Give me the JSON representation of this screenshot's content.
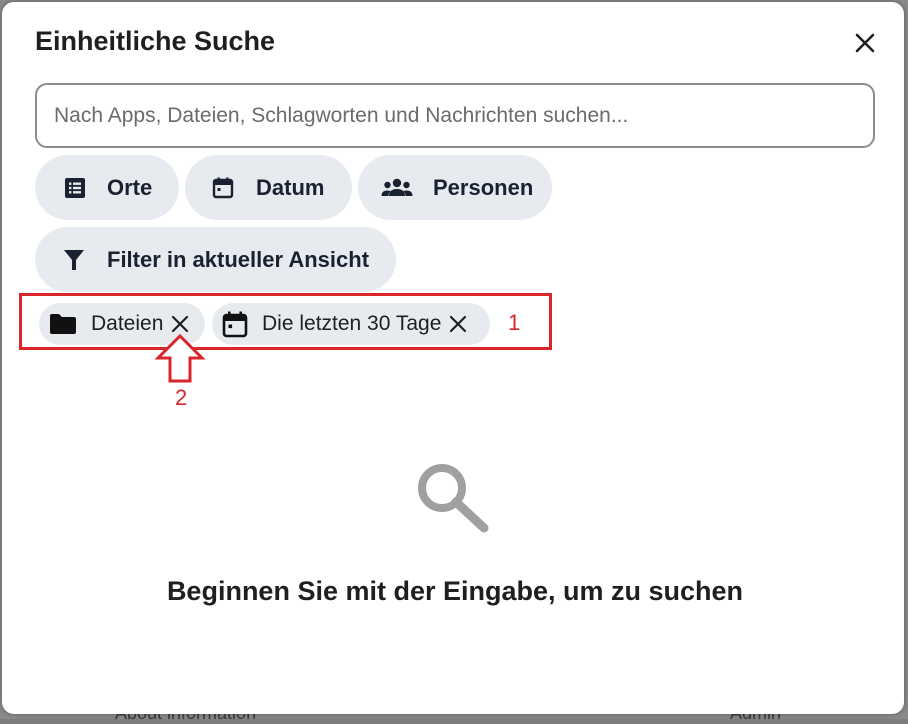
{
  "dialog": {
    "title": "Einheitliche Suche",
    "search_placeholder": "Nach Apps, Dateien, Schlagworten und Nachrichten suchen..."
  },
  "filter_buttons": {
    "places": "Orte",
    "date": "Datum",
    "people": "Personen",
    "current_view": "Filter in aktueller Ansicht"
  },
  "active_filters": [
    {
      "label": "Dateien",
      "icon": "folder-icon"
    },
    {
      "label": "Die letzten 30 Tage",
      "icon": "calendar-icon"
    }
  ],
  "annotations": {
    "marker_1": "1",
    "marker_2": "2",
    "color": "#d9262b"
  },
  "empty_state": {
    "icon": "magnifier-icon",
    "message": "Beginnen Sie mit der Eingabe, um zu suchen"
  },
  "background_page": {
    "partial_text": "About information",
    "partial_text_right": "Admin"
  },
  "colors": {
    "chip_background": "#e7ebf0",
    "chip_text": "#1a2130",
    "search_border": "#8c8c8c"
  }
}
